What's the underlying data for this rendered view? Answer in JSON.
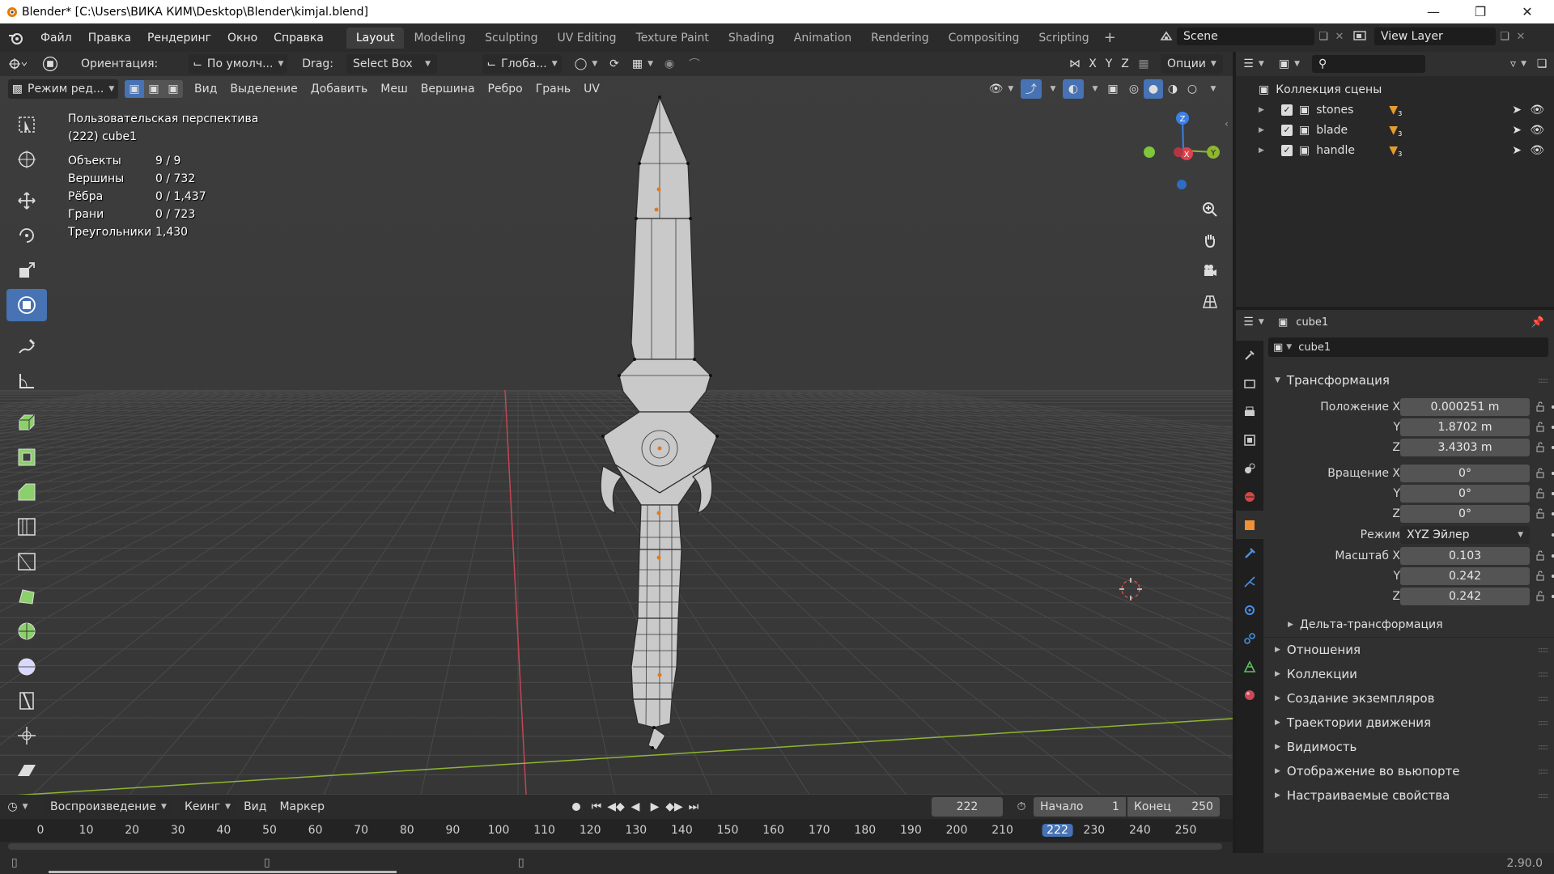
{
  "window": {
    "title": "Blender* [C:\\Users\\ВИКА КИМ\\Desktop\\Blender\\kimjal.blend]",
    "version": "2.90.0"
  },
  "topmenu": {
    "items": [
      "Файл",
      "Правка",
      "Рендеринг",
      "Окно",
      "Справка"
    ],
    "workspaces": [
      "Layout",
      "Modeling",
      "Sculpting",
      "UV Editing",
      "Texture Paint",
      "Shading",
      "Animation",
      "Rendering",
      "Compositing",
      "Scripting"
    ],
    "scene": "Scene",
    "view_layer": "View Layer"
  },
  "viewport_header": {
    "orientation_label": "Ориентация:",
    "orientation_value": "По умолч...",
    "drag_label": "Drag:",
    "drag_value": "Select Box",
    "pivot_value": "Глоба...",
    "options": "Опции",
    "axes": [
      "X",
      "Y",
      "Z"
    ]
  },
  "editmode_header": {
    "mode": "Режим ред...",
    "menus": [
      "Вид",
      "Выделение",
      "Добавить",
      "Меш",
      "Вершина",
      "Ребро",
      "Грань",
      "UV"
    ]
  },
  "overlay": {
    "view_name": "Пользовательская перспектива",
    "object_name": "(222) cube1",
    "stats": [
      {
        "key": "Объекты",
        "value": "9 / 9"
      },
      {
        "key": "Вершины",
        "value": "0 / 732"
      },
      {
        "key": "Рёбра",
        "value": "0 / 1,437"
      },
      {
        "key": "Грани",
        "value": "0 / 723"
      },
      {
        "key": "Треугольники",
        "value": "1,430"
      }
    ]
  },
  "gizmo": {
    "x": "X",
    "y": "Y",
    "z": "Z"
  },
  "timeline": {
    "menus": [
      "Воспроизведение",
      "Кеинг",
      "Вид",
      "Маркер"
    ],
    "current_frame": "222",
    "start_label": "Начало",
    "start_value": "1",
    "end_label": "Конец",
    "end_value": "250",
    "ticks": [
      "0",
      "10",
      "20",
      "30",
      "40",
      "50",
      "60",
      "70",
      "80",
      "90",
      "100",
      "110",
      "120",
      "130",
      "140",
      "150",
      "160",
      "170",
      "180",
      "190",
      "200",
      "210",
      "222",
      "230",
      "240",
      "250"
    ]
  },
  "outliner": {
    "collection": "Коллекция сцены",
    "items": [
      {
        "name": "stones",
        "count": "3"
      },
      {
        "name": "blade",
        "count": "3"
      },
      {
        "name": "handle",
        "count": "3"
      }
    ]
  },
  "properties": {
    "object_header": "cube1",
    "object_name": "cube1",
    "transform_title": "Трансформация",
    "location_label": "Положение X",
    "location": [
      "0.000251 m",
      "1.8702 m",
      "3.4303 m"
    ],
    "rotation_label": "Вращение X",
    "rotation": [
      "0°",
      "0°",
      "0°"
    ],
    "mode_label": "Режим",
    "mode_value": "XYZ Эйлер",
    "scale_label": "Масштаб X",
    "scale": [
      "0.103",
      "0.242",
      "0.242"
    ],
    "axis_y": "Y",
    "axis_z": "Z",
    "delta": "Дельта-трансформация",
    "sections": [
      "Отношения",
      "Коллекции",
      "Создание экземпляров",
      "Траектории движения",
      "Видимость",
      "Отображение во вьюпорте",
      "Настраиваемые свойства"
    ]
  },
  "colors": {
    "accent": "#4772b3",
    "axis_x": "#e0414f",
    "axis_y": "#8db631",
    "axis_z": "#3c7fe8",
    "vertex": "#e07a1f"
  }
}
